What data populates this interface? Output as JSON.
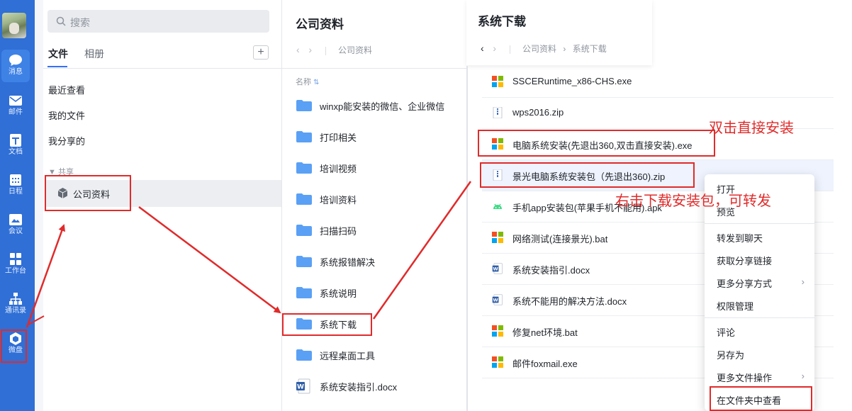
{
  "rail": {
    "items": [
      {
        "label": "消息",
        "icon": "chat-bubble-icon"
      },
      {
        "label": "邮件",
        "icon": "mail-icon"
      },
      {
        "label": "文档",
        "icon": "doc-icon"
      },
      {
        "label": "日程",
        "icon": "calendar-icon"
      },
      {
        "label": "会议",
        "icon": "meeting-icon"
      },
      {
        "label": "工作台",
        "icon": "grid-icon"
      },
      {
        "label": "通讯录",
        "icon": "org-chart-icon"
      },
      {
        "label": "微盘",
        "icon": "cloud-drive-icon"
      }
    ]
  },
  "sidebar": {
    "search_placeholder": "搜索",
    "tabs": [
      "文件",
      "相册"
    ],
    "add_label": "+",
    "nav": [
      "最近查看",
      "我的文件",
      "我分享的"
    ],
    "shared_section": "▼ 共享",
    "selected": "公司资料"
  },
  "folder_panel": {
    "title": "公司资料",
    "breadcrumb": "公司资料",
    "column_name": "名称",
    "sort_icon": "sort-icon",
    "items": [
      {
        "name": "winxp能安装的微信、企业微信",
        "type": "folder"
      },
      {
        "name": "打印相关",
        "type": "folder"
      },
      {
        "name": "培训视频",
        "type": "folder"
      },
      {
        "name": "培训资料",
        "type": "folder"
      },
      {
        "name": "扫描扫码",
        "type": "folder"
      },
      {
        "name": "系统报错解决",
        "type": "folder"
      },
      {
        "name": "系统说明",
        "type": "folder"
      },
      {
        "name": "系统下载",
        "type": "folder"
      },
      {
        "name": "远程桌面工具",
        "type": "folder"
      },
      {
        "name": "系统安装指引.docx",
        "type": "word"
      }
    ]
  },
  "download_panel": {
    "title": "系统下载",
    "breadcrumb": [
      "公司资料",
      "系统下载"
    ],
    "files": [
      {
        "name": "SSCERuntime_x86-CHS.exe",
        "type": "exe"
      },
      {
        "name": "wps2016.zip",
        "type": "zip"
      },
      {
        "name": "电脑系统安装(先退出360,双击直接安装).exe",
        "type": "exe"
      },
      {
        "name": "景光电脑系统安装包（先退出360).zip",
        "type": "zip"
      },
      {
        "name": "手机app安装包(苹果手机不能用).apk",
        "type": "apk"
      },
      {
        "name": "网络测试(连接景光).bat",
        "type": "exe"
      },
      {
        "name": "系统安装指引.docx",
        "type": "word"
      },
      {
        "name": "系统不能用的解决方法.docx",
        "type": "word"
      },
      {
        "name": "修复net环境.bat",
        "type": "exe"
      },
      {
        "name": "邮件foxmail.exe",
        "type": "exe"
      }
    ]
  },
  "context_menu": {
    "items": [
      "打开",
      "预览",
      "转发到聊天",
      "获取分享链接",
      "更多分享方式",
      "权限管理",
      "评论",
      "另存为",
      "更多文件操作",
      "在文件夹中查看"
    ]
  },
  "annotations": {
    "double_click": "双击直接安装",
    "right_click": "右击下载安装包，可转发"
  },
  "colors": {
    "rail": "#2f6fd6",
    "annotation": "#e02b2b",
    "folder": "#5aa0f5",
    "highlight": "#eef3fe"
  }
}
